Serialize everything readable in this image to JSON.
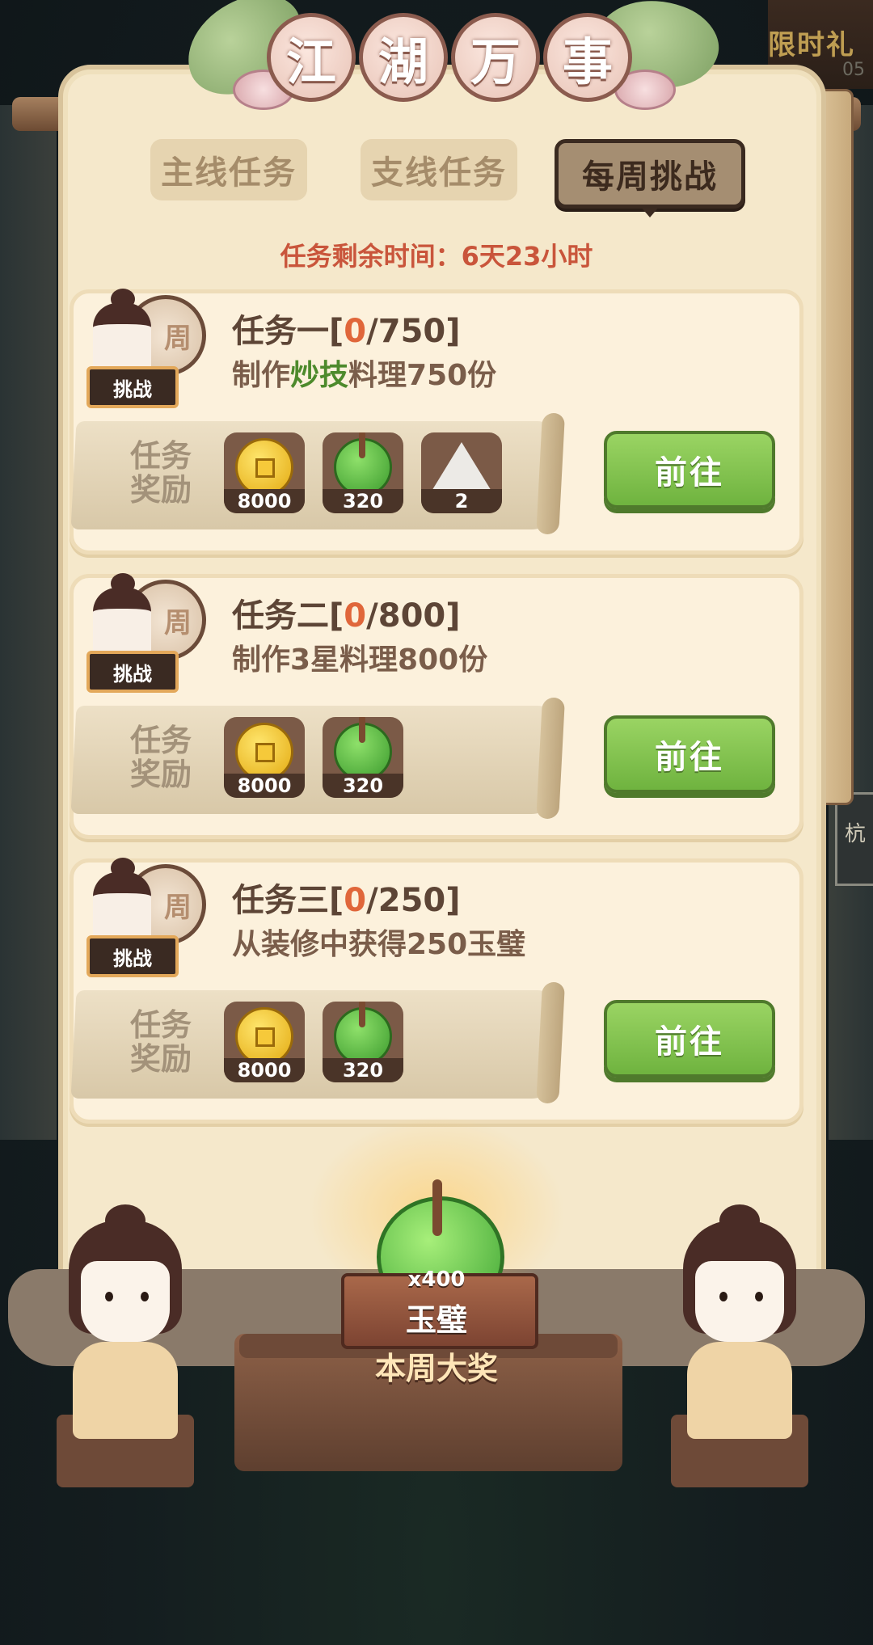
{
  "header": {
    "title_chars": [
      "江",
      "湖",
      "万",
      "事"
    ],
    "corner_event_label": "限时礼包",
    "corner_event_time": "05"
  },
  "tabs": [
    {
      "label": "主线任务",
      "active": false
    },
    {
      "label": "支线任务",
      "active": false
    },
    {
      "label": "每周挑战",
      "active": true
    }
  ],
  "remaining_time": "任务剩余时间：6天23小时",
  "avatar": {
    "coin_char": "周",
    "badge": "挑战"
  },
  "reward_label": "任务奖励",
  "go_label": "前往",
  "tasks": [
    {
      "name": "任务一",
      "bracket_open": "[",
      "progress_current": "0",
      "progress_rest": "/750]",
      "desc_pre": "制作",
      "desc_highlight": "炒技",
      "desc_post": "料理750份",
      "rewards": [
        {
          "icon": "copper-coin-icon",
          "count": "8000"
        },
        {
          "icon": "jade-disc-icon",
          "count": "320"
        },
        {
          "icon": "rice-ball-icon",
          "count": "2"
        }
      ]
    },
    {
      "name": "任务二",
      "bracket_open": "[",
      "progress_current": "0",
      "progress_rest": "/800]",
      "desc_pre": "制作3星料理800份",
      "desc_highlight": "",
      "desc_post": "",
      "rewards": [
        {
          "icon": "copper-coin-icon",
          "count": "8000"
        },
        {
          "icon": "jade-disc-icon",
          "count": "320"
        }
      ]
    },
    {
      "name": "任务三",
      "bracket_open": "[",
      "progress_current": "0",
      "progress_rest": "/250]",
      "desc_pre": "从装修中获得250玉璧",
      "desc_highlight": "",
      "desc_post": "",
      "rewards": [
        {
          "icon": "copper-coin-icon",
          "count": "8000"
        },
        {
          "icon": "jade-disc-icon",
          "count": "320"
        }
      ]
    }
  ],
  "grand_prize": {
    "count": "x400",
    "name": "玉璧",
    "caption": "本周大奖",
    "icon": "jade-disc-icon"
  },
  "right_sign_char": "杭",
  "colors": {
    "panel": "#f5e8cb",
    "go_button": "#7fc04b",
    "progress_highlight": "#e0663a",
    "desc_highlight": "#4d8a2c",
    "time_text": "#c9553b"
  }
}
